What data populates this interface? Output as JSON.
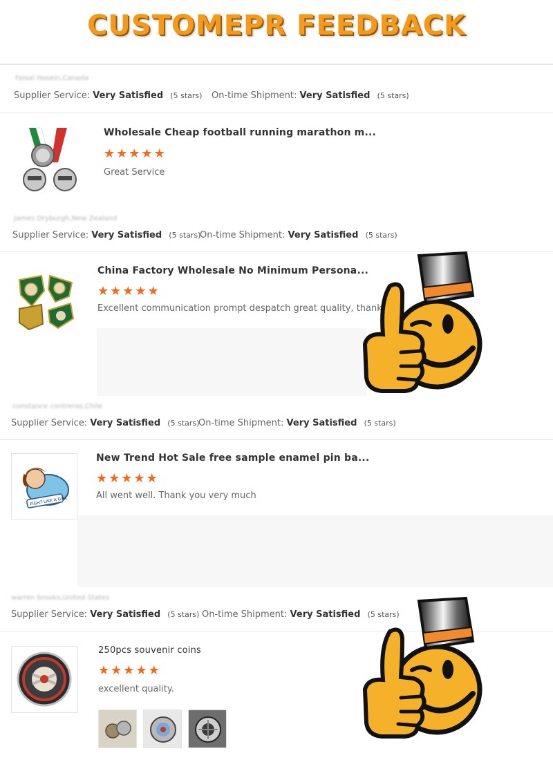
{
  "banner": {
    "title": "CUSTOMEPR FEEDBACK"
  },
  "labels": {
    "supplier_service": "Supplier Service:",
    "ontime_shipment": "On-time Shipment:"
  },
  "reviews": [
    {
      "reviewer": "Faisal Hosein,Canada",
      "supplier_value": "Very Satisfied",
      "supplier_stars": "(5 stars)",
      "shipment_value": "Very Satisfied",
      "shipment_stars": "(5 stars)",
      "product_title": "Wholesale Cheap football running marathon m...",
      "rating": 5,
      "comment": "Great Service"
    },
    {
      "reviewer": "James Dryburgh,New Zealand",
      "supplier_value": "Very Satisfied",
      "supplier_stars": "(5 stars)",
      "shipment_value": "Very Satisfied",
      "shipment_stars": "(5 stars)",
      "product_title": "China Factory Wholesale No Minimum Persona...",
      "rating": 5,
      "comment": "Excellent communication  prompt despatch great quality, thanks"
    },
    {
      "reviewer": "constance contreras,Chile",
      "supplier_value": "Very Satisfied",
      "supplier_stars": "(5 stars)",
      "shipment_value": "Very Satisfied",
      "shipment_stars": "(5 stars)",
      "product_title": "New Trend Hot Sale free sample enamel pin ba...",
      "rating": 5,
      "comment": "All went well. Thank you very much",
      "pin_text": "FIGHT LIKE A GIRL"
    },
    {
      "reviewer": "warren brooks,United States",
      "supplier_value": "Very Satisfied",
      "supplier_stars": "(5 stars)",
      "shipment_value": "Very Satisfied",
      "shipment_stars": "(5 stars)",
      "product_title": "250pcs souvenir coins",
      "rating": 5,
      "comment": "excellent quality."
    }
  ],
  "colors": {
    "accent": "#f39a1e",
    "star": "#f26a1b",
    "emoji": "#f6b12a"
  },
  "icons": {
    "star": "★",
    "emoji": "thumbs-up-emoji-icon"
  }
}
